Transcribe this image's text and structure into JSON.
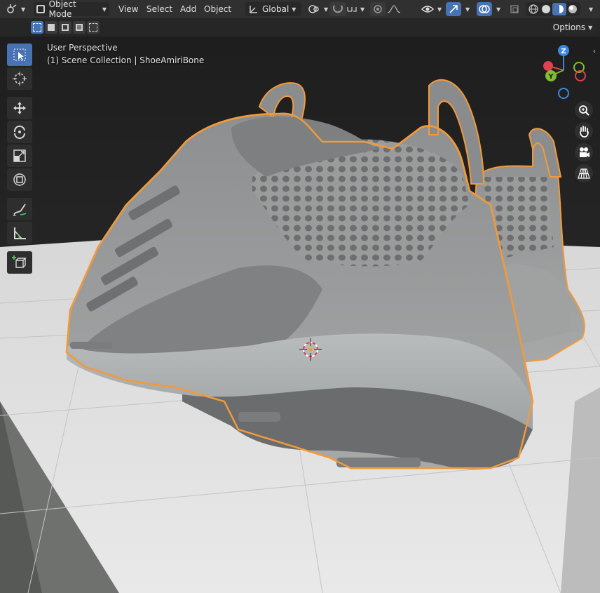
{
  "header": {
    "mode_label": "Object Mode",
    "menus": [
      "View",
      "Select",
      "Add",
      "Object"
    ],
    "transform_orientation": "Global",
    "options_label": "Options"
  },
  "viewport": {
    "perspective_label": "User Perspective",
    "collection_label": "(1) Scene Collection | ShoeAmiriBone"
  },
  "gizmo": {
    "axes": [
      "Z",
      "Y",
      "X"
    ]
  },
  "icons": {
    "editor_type": "editor-type-icon",
    "transform_orientation": "orientation-icon",
    "pivot": "pivot-icon",
    "snap": "snap-icon",
    "proportional": "proportional-icon",
    "visibility": "visibility-icon",
    "gizmo_toggle": "gizmo-toggle-icon",
    "overlay": "overlay-icon",
    "xray": "xray-icon",
    "shading_wire": "wireframe-shading-icon",
    "shading_solid": "solid-shading-icon",
    "shading_material": "material-shading-icon",
    "shading_render": "rendered-shading-icon"
  },
  "colors": {
    "accent": "#4772b3",
    "selection_outline": "#f29a3b",
    "axis_x": "#e0404f",
    "axis_y": "#7fbf2f",
    "axis_z": "#3b87e0"
  }
}
